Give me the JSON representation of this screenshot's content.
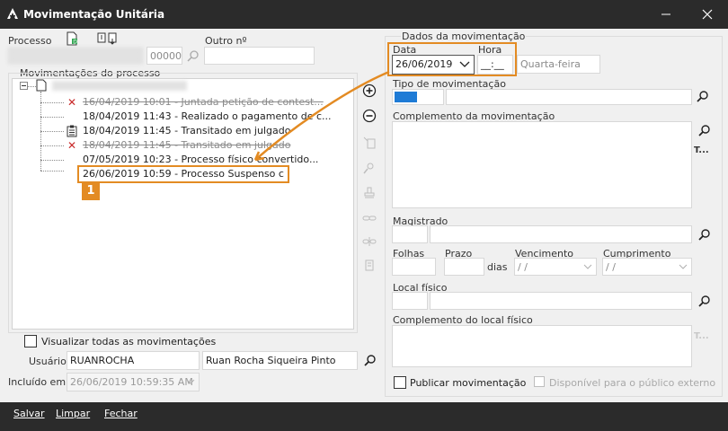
{
  "window": {
    "title": "Movimentação Unitária",
    "controls": [
      "minimize",
      "maximize",
      "close"
    ]
  },
  "left": {
    "processo_label": "Processo",
    "processo_suffix": "00000",
    "outro_label": "Outro nº",
    "mov_group_label": "Movimentações do processo",
    "tree": [
      {
        "icon": "x",
        "text": "16/04/2019 10:01 - Juntada petição de contest...",
        "struck": true
      },
      {
        "icon": "none",
        "text": "18/04/2019 11:43 - Realizado o pagamento de c...",
        "struck": false
      },
      {
        "icon": "doc",
        "text": "18/04/2019 11:45 - Transitado em julgado",
        "struck": false
      },
      {
        "icon": "x",
        "text": "18/04/2019 11:45 - Transitado em julgado",
        "struck": true
      },
      {
        "icon": "none",
        "text": "07/05/2019 10:23 - Processo físico convertido...",
        "struck": false
      },
      {
        "icon": "none",
        "text": "26/06/2019 10:59 - Processo Suspenso c",
        "struck": false,
        "selected": true
      }
    ],
    "visualizar_label": "Visualizar todas as movimentações",
    "usuario_label": "Usuário",
    "usuario_login": "RUANROCHA",
    "usuario_nome": "Ruan Rocha Siqueira Pinto",
    "incluido_label": "Incluído em :",
    "incluido_value": "26/06/2019 10:59:35 AM"
  },
  "right": {
    "group_label": "Dados da movimentação",
    "data_label": "Data",
    "data_value": "26/06/2019",
    "hora_label": "Hora",
    "hora_value": "__:__",
    "dia_semana": "Quarta-feira",
    "tipo_label": "Tipo de movimentação",
    "complemento_label": "Complemento da movimentação",
    "text_tool": "T...",
    "magistrado_label": "Magistrado",
    "folhas_label": "Folhas",
    "prazo_label": "Prazo",
    "dias_label": "dias",
    "vencimento_label": "Vencimento",
    "vencimento_value": " / /",
    "cumprimento_label": "Cumprimento",
    "cumprimento_value": " / /",
    "local_label": "Local físico",
    "comp_local_label": "Complemento do local físico",
    "publicar_label": "Publicar movimentação",
    "disponivel_label": "Disponível para o público externo"
  },
  "callout_number": "1",
  "bottom": {
    "salvar": "Salvar",
    "limpar": "Limpar",
    "fechar": "Fechar"
  },
  "colors": {
    "accent": "#e38b23",
    "titlebar": "#2b2b2b",
    "delete_red": "#c82828",
    "progress_blue": "#1e7bd6"
  }
}
